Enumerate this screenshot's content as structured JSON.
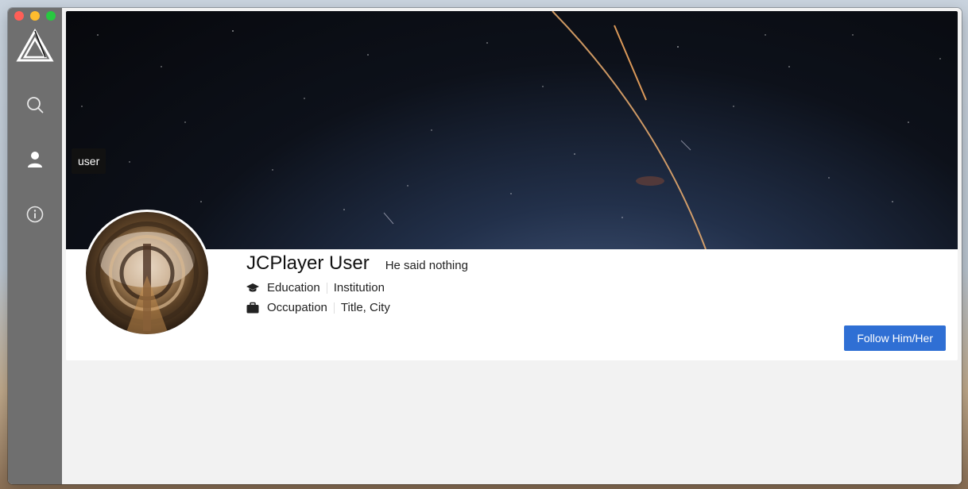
{
  "sidebar": {
    "items": [
      {
        "name": "search",
        "icon": "search-icon"
      },
      {
        "name": "user",
        "icon": "user-icon"
      },
      {
        "name": "info",
        "icon": "info-icon"
      }
    ],
    "tooltip": "user"
  },
  "profile": {
    "name": "JCPlayer User",
    "bio": "He said nothing",
    "education_label": "Education",
    "education_value": "Institution",
    "occupation_label": "Occupation",
    "occupation_value": "Title, City",
    "follow_label": "Follow Him/Her"
  },
  "colors": {
    "sidebar": "#6f6f6f",
    "accent": "#2f6fd4",
    "content_bg": "#f2f2f2"
  }
}
